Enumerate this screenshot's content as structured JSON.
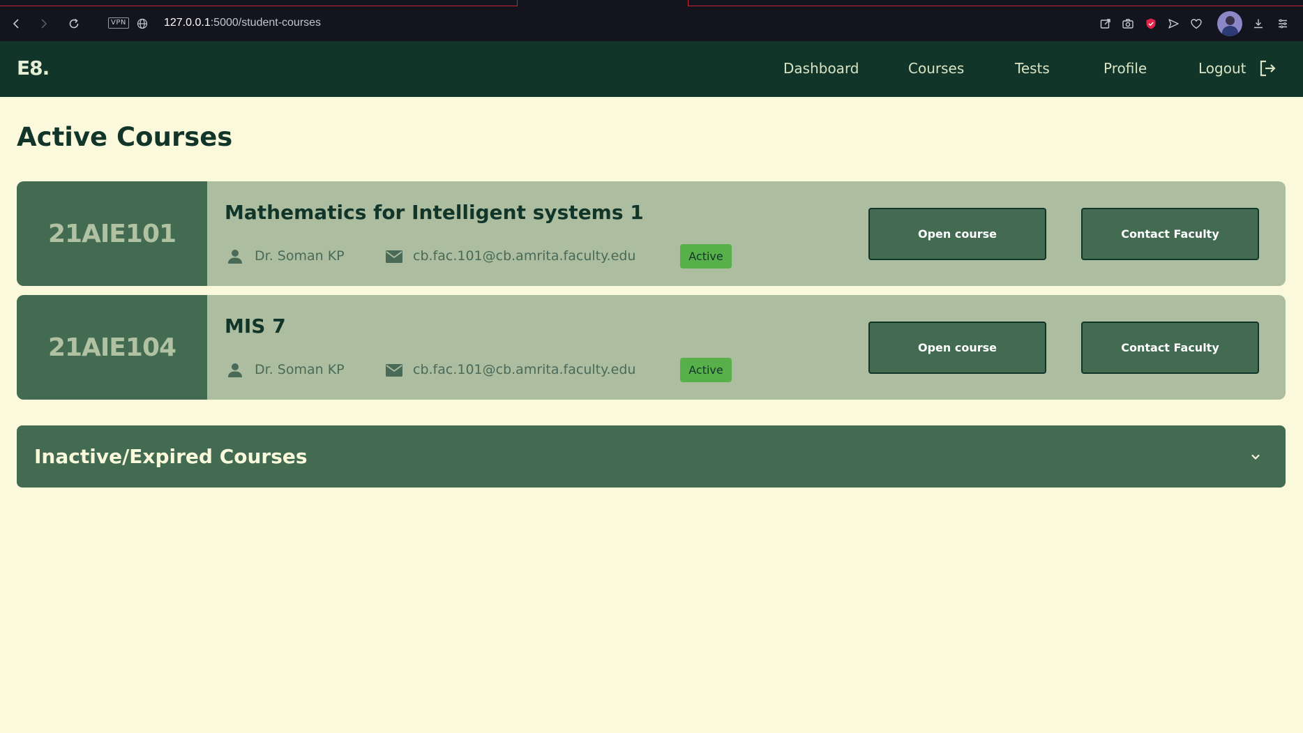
{
  "browser": {
    "url_host": "127.0.0.1",
    "url_path": ":5000/student-courses",
    "vpn_label": "VPN"
  },
  "app": {
    "logo": "E8.",
    "nav": {
      "dashboard": "Dashboard",
      "courses": "Courses",
      "tests": "Tests",
      "profile": "Profile",
      "logout": "Logout"
    }
  },
  "page": {
    "title": "Active Courses"
  },
  "courses": [
    {
      "code": "21AIE101",
      "name": "Mathematics for Intelligent systems 1",
      "faculty": "Dr. Soman KP",
      "email": "cb.fac.101@cb.amrita.faculty.edu",
      "status": "Active",
      "open_label": "Open course",
      "contact_label": "Contact Faculty"
    },
    {
      "code": "21AIE104",
      "name": "MIS 7",
      "faculty": "Dr. Soman KP",
      "email": "cb.fac.101@cb.amrita.faculty.edu",
      "status": "Active",
      "open_label": "Open course",
      "contact_label": "Contact Faculty"
    }
  ],
  "inactive_section": {
    "title": "Inactive/Expired Courses"
  },
  "icons": {
    "back": "arrow-left-icon",
    "forward": "arrow-right-icon",
    "reload": "reload-icon",
    "site": "globe-icon",
    "person": "person-icon",
    "email": "mail-icon",
    "logout": "logout-icon",
    "chevron": "chevron-down-icon"
  },
  "colors": {
    "nav_bg": "#12352a",
    "page_bg": "#fbf9dc",
    "card_bg": "#adbd9f",
    "accent": "#436b51",
    "badge": "#58b04b"
  }
}
